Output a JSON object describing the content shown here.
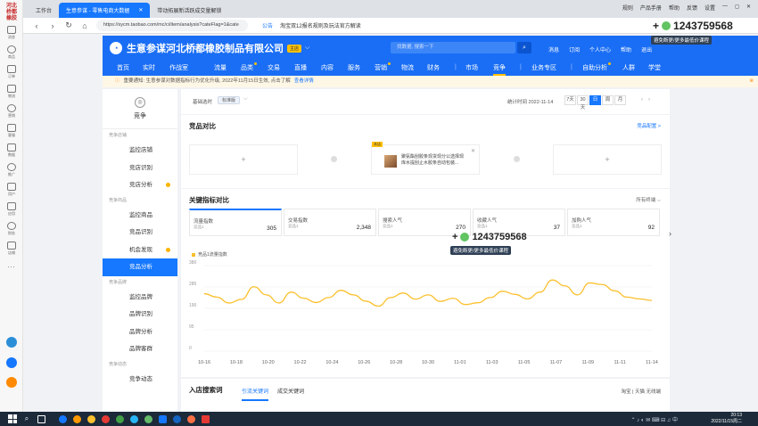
{
  "rail": {
    "logo_lines": [
      "河北",
      "桥都",
      "橡胶"
    ],
    "items": [
      "消息",
      "商品",
      "订单",
      "物流",
      "营销",
      "客服",
      "数据",
      "推广",
      "用户",
      "应用",
      "财务",
      "店铺"
    ]
  },
  "browser": {
    "tabs": [
      {
        "label": "工作台",
        "active": false
      },
      {
        "label": "生意参谋 - 零售电商大数据",
        "active": true
      },
      {
        "label": "带动拓展新活跃成交量解锁",
        "active": false
      }
    ],
    "window_links": [
      "规则",
      "产品手册",
      "帮助",
      "反馈",
      "设置"
    ],
    "url": "https://sycm.taobao.com/mc/ci/item/analysis?cateFlag=1&cate",
    "bookmark_tip": "公告",
    "bookmark_text": "淘宝双12报名规则及玩法官方解读"
  },
  "header": {
    "brand": "生意参谋",
    "company": "河北桥都橡胶制品有限公司",
    "badge": "主店",
    "search_placeholder": "找数据, 搜索一下",
    "links": [
      "消息",
      "订阅",
      "个人中心",
      "帮助",
      "退出"
    ]
  },
  "nav": {
    "items": [
      "首页",
      "实时",
      "作战室",
      "流量",
      "品类",
      "交易",
      "直播",
      "内容",
      "服务",
      "营销",
      "物流",
      "财务",
      "市场",
      "竞争",
      "业务专区",
      "自助分析",
      "人群",
      "学堂"
    ],
    "active": "竞争"
  },
  "notice": {
    "text": "重要通知: 生意参谋对数据指标行为优化升级, 2022年11月15日生效, 点击了解",
    "link": "查看详情"
  },
  "leftmenu": {
    "title": "竞争",
    "groups": [
      {
        "label": "竞争店铺",
        "items": [
          {
            "label": "监控店铺",
            "dot": false,
            "active": false
          },
          {
            "label": "竞店识别",
            "dot": false,
            "active": false
          },
          {
            "label": "竞店分析",
            "dot": true,
            "active": false
          }
        ]
      },
      {
        "label": "竞争商品",
        "items": [
          {
            "label": "监控商品",
            "dot": false,
            "active": false
          },
          {
            "label": "竞品识别",
            "dot": false,
            "active": false
          },
          {
            "label": "机会发现",
            "dot": true,
            "active": false
          },
          {
            "label": "竞品分析",
            "dot": false,
            "active": true
          }
        ]
      },
      {
        "label": "竞争品牌",
        "items": [
          {
            "label": "监控品牌",
            "dot": false,
            "active": false
          },
          {
            "label": "品牌识别",
            "dot": false,
            "active": false
          },
          {
            "label": "品牌分析",
            "dot": false,
            "active": false
          },
          {
            "label": "品牌客群",
            "dot": false,
            "active": false
          }
        ]
      },
      {
        "label": "竞争动态",
        "items": [
          {
            "label": "竞争动态",
            "dot": false,
            "active": false
          }
        ]
      }
    ]
  },
  "filter": {
    "label": "基础选时",
    "select": "标准版",
    "stat_time": "统计时间 2022-11-14",
    "ranges": [
      "7天",
      "30天",
      "日",
      "周",
      "月"
    ],
    "active_range": "日"
  },
  "compare": {
    "title": "竞品对比",
    "link": "竞品配置 >",
    "add_symbol": "+",
    "product_tag": "本店",
    "product_title": "聚氨酯刮胶条现货现分公选择现库水提刮止水胶条自动包装..."
  },
  "metrics": {
    "title": "关键指标对比",
    "filter": "所有终端",
    "cards": [
      {
        "name": "流量指数",
        "sub": "竞品1",
        "value": "305"
      },
      {
        "name": "交易指数",
        "sub": "竞品1",
        "value": "2,348"
      },
      {
        "name": "搜索人气",
        "sub": "竞品1",
        "value": "270"
      },
      {
        "name": "收藏人气",
        "sub": "竞品1",
        "value": "37"
      },
      {
        "name": "加购人气",
        "sub": "竞品1",
        "value": "92"
      }
    ]
  },
  "chart_data": {
    "type": "line",
    "series": [
      {
        "name": "竞品1流量指数",
        "values": [
          255,
          240,
          214,
          230,
          286,
          250,
          214,
          262,
          235,
          216,
          238,
          270,
          250,
          222,
          200,
          238,
          258,
          231,
          250,
          221,
          235,
          207,
          215,
          238,
          266,
          252,
          232,
          262,
          316,
          290,
          250,
          303,
          296,
          268,
          240,
          232,
          225
        ]
      }
    ],
    "x_tick_labels": [
      "10-16",
      "10-18",
      "10-20",
      "10-22",
      "10-24",
      "10-26",
      "10-28",
      "10-30",
      "11-01",
      "11-03",
      "11-05",
      "11-07",
      "11-09",
      "11-11",
      "11-14"
    ],
    "y_ticks": [
      0,
      95,
      190,
      285,
      380
    ],
    "ylim": [
      0,
      380
    ],
    "color": "#fbc02d",
    "grid": true
  },
  "keywords": {
    "title": "入店搜索词",
    "tabs": [
      "引流关键词",
      "成交关键词"
    ],
    "right": "淘宝 | 天猫  无线端"
  },
  "watermark": {
    "number": "1243759568",
    "caption": "避免断更/更多最低价课程"
  },
  "clock": {
    "time": "20:13",
    "date": "2022/11/15周二"
  }
}
